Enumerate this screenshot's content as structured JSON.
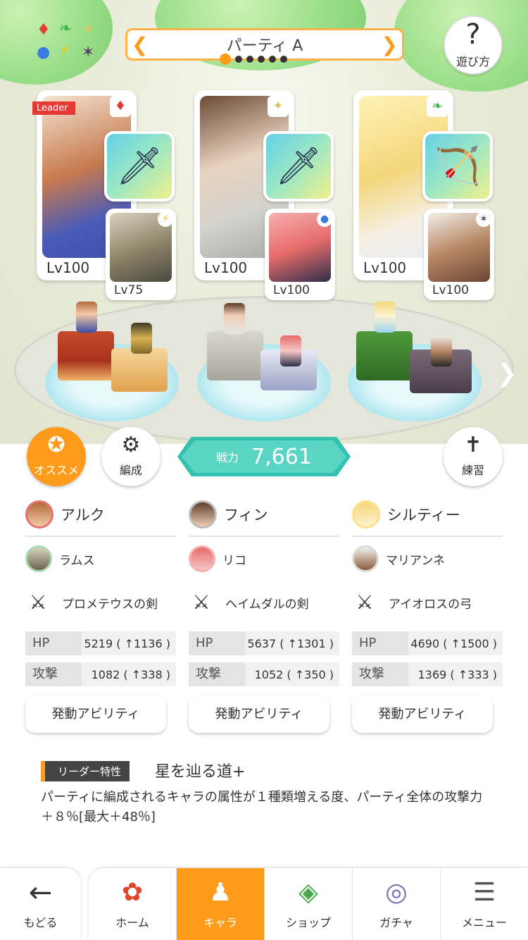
{
  "header": {
    "party_title": "パーティ A",
    "prev_arrow": "❮",
    "next_arrow": "❯",
    "help_symbol": "?",
    "help_label": "遊び方",
    "page_count": 6,
    "current_page": 1
  },
  "elements": {
    "fire": "♦",
    "wind": "❧",
    "light": "✦",
    "water": "●",
    "thunder": "⚡",
    "dark": "✶"
  },
  "units": [
    {
      "leader_tag": "Leader",
      "main_name": "アルク",
      "main_level": "Lv100",
      "main_element": "♦",
      "weapon_icon": "🗡",
      "sub_name": "ラムス",
      "sub_level": "Lv75",
      "sub_element": "⚡",
      "weapon_name": "プロメテウスの剣",
      "hp_label": "HP",
      "hp_value": "5219 ( ↑1136 )",
      "atk_label": "攻撃",
      "atk_value": "1082 ( ↑338 )",
      "ability_label": "発動アビリティ"
    },
    {
      "main_name": "フィン",
      "main_level": "Lv100",
      "main_element": "✦",
      "weapon_icon": "🗡",
      "sub_name": "リコ",
      "sub_level": "Lv100",
      "sub_element": "●",
      "weapon_name": "ヘイムダルの剣",
      "hp_label": "HP",
      "hp_value": "5637 ( ↑1301 )",
      "atk_label": "攻撃",
      "atk_value": "1052 ( ↑350 )",
      "ability_label": "発動アビリティ"
    },
    {
      "main_name": "シルティー",
      "main_level": "Lv100",
      "main_element": "❧",
      "weapon_icon": "🏹",
      "sub_name": "マリアンネ",
      "sub_level": "Lv100",
      "sub_element": "✶",
      "weapon_name": "アイオロスの弓",
      "hp_label": "HP",
      "hp_value": "4690 ( ↑1500 )",
      "atk_label": "攻撃",
      "atk_value": "1369 ( ↑333 )",
      "ability_label": "発動アビリティ"
    }
  ],
  "buttons": {
    "recommend": "オススメ",
    "formation": "編成",
    "practice": "練習"
  },
  "power": {
    "label": "戦力",
    "value": "7,661"
  },
  "leader_skill": {
    "label": "リーダー特性",
    "name": "星を辿る道+",
    "description": "パーティに編成されるキャラの属性が１種類増える度、パーティ全体の攻撃力＋８％[最大＋48％]"
  },
  "nav": {
    "back_label": "もどる",
    "back_icon": "←",
    "tabs": [
      {
        "label": "ホーム",
        "icon": "✿"
      },
      {
        "label": "キャラ",
        "icon": "♟"
      },
      {
        "label": "ショップ",
        "icon": "◈"
      },
      {
        "label": "ガチャ",
        "icon": "◎"
      },
      {
        "label": "メニュー",
        "icon": "☰"
      }
    ],
    "active_tab": "キャラ"
  },
  "colors": {
    "accent": "#ff9b1a",
    "power": "#33c1b0",
    "leader": "#e53935"
  }
}
